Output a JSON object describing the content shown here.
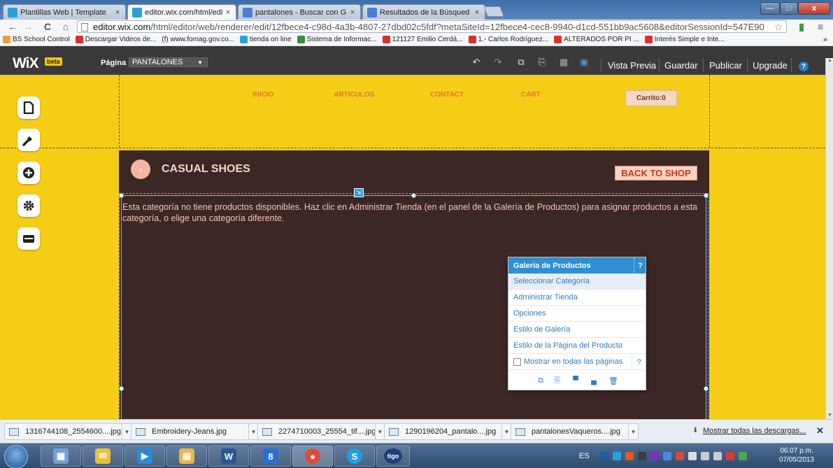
{
  "browser": {
    "tabs": [
      {
        "label": "Plantillas Web | Template",
        "icon_color": "#2a9fd8"
      },
      {
        "label": "editor.wix.com/html/edito",
        "icon_color": "#2a9fd8"
      },
      {
        "label": "pantalones - Buscar con G",
        "icon_color": "#4a7fd8"
      },
      {
        "label": "Resultados de la Búsqued",
        "icon_color": "#4a7fd8"
      }
    ],
    "close_glyph": "×",
    "window_controls": {
      "minimize": "—",
      "maximize": "□",
      "close": "x"
    },
    "nav": {
      "back": "←",
      "forward": "→",
      "reload": "C",
      "home": "⌂"
    },
    "url_domain": "editor.wix.com",
    "url_rest": "/html/editor/web/renderer/edit/12fbece4-c98d-4a3b-4807-27dbd02c5fdf?metaSiteId=12fbece4-cec8-9940-d1cd-551bb9ac5608&editorSessionId=547E90",
    "star_glyph": "☆",
    "menu_glyph": "≡",
    "bookmarks": [
      {
        "label": "BS School Control",
        "color": "#e6a23c"
      },
      {
        "label": "Descargar Videos de...",
        "color": "#d9322b"
      },
      {
        "label": "(f) www.fomag.gov.co...",
        "color": "#f5f6f7"
      },
      {
        "label": "tienda on line",
        "color": "#2a9fd8"
      },
      {
        "label": "Sistema de Informac...",
        "color": "#3a8a3a"
      },
      {
        "label": "121127 Emilio Cerdá...",
        "color": "#d9322b"
      },
      {
        "label": "1.- Carlos Rodríguez...",
        "color": "#d9322b"
      },
      {
        "label": "ALTERADOS POR PI ...",
        "color": "#d9322b"
      },
      {
        "label": "Interés Simple e Inte...",
        "color": "#d9322b"
      }
    ],
    "bookmarks_more": "»"
  },
  "wix": {
    "logo": "WiX",
    "beta": "beta",
    "page_label": "Página",
    "page_value": "PANTALONES",
    "page_caret": "▼",
    "tools": [
      "↶",
      "↷",
      "⧉",
      "⎘",
      "▦",
      "▣"
    ],
    "buttons": {
      "preview": "Vista Previa",
      "save": "Guardar",
      "publish": "Publicar",
      "upgrade": "Upgrade"
    },
    "help": "?"
  },
  "site": {
    "menu": [
      "INICIO",
      "ARTICULOS",
      "CONTACT",
      "CART"
    ],
    "cart": "Carrito:0",
    "sidebar_icons": [
      "page-icon",
      "design-icon",
      "add-icon",
      "settings-icon",
      "store-icon"
    ],
    "category_title": "CASUAL SHOES",
    "back_to_shop": "BACK TO SHOP",
    "empty_message": "Esta categoría no tiene productos disponibles. Haz clic en Administrar Tienda (en el panel de la Galería de Productos) para asignar productos a esta categoría, o elige una categoría diferente."
  },
  "panel": {
    "title": "Galería de Productos",
    "help": "?",
    "items": [
      "Seleccionar Categoría",
      "Administrar Tienda",
      "Opciones",
      "Estilo de Galería",
      "Estilo de la Página del Producto"
    ],
    "checkbox_label": "Mostrar en todas las páginas",
    "checkbox_checked": false,
    "checkbox_help": "?",
    "icons": [
      "⧉",
      "⎘",
      "▀",
      "▄",
      "🗑"
    ]
  },
  "downloads": {
    "files": [
      "1316744108_2554600....jpg",
      "Embroidery-Jeans.jpg",
      "2274710003_25554_tif....jpg",
      "1290196204_pantalo....jpg",
      "pantalonesVaqueros....jpg"
    ],
    "dropdown_glyph": "▼",
    "show_all": "Mostrar todas las descargas...",
    "close": "✕"
  },
  "taskbar": {
    "apps": [
      {
        "name": "calculator",
        "color": "#6ea3d8",
        "glyph": "▦"
      },
      {
        "name": "mail",
        "color": "#e8c23a",
        "glyph": "✉"
      },
      {
        "name": "media-player",
        "color": "#2e8ad6",
        "glyph": "▶"
      },
      {
        "name": "file-explorer",
        "color": "#e8b84a",
        "glyph": "▤"
      },
      {
        "name": "word",
        "color": "#2b5797",
        "glyph": "W"
      },
      {
        "name": "google",
        "color": "#2c6fd1",
        "glyph": "8"
      },
      {
        "name": "chrome",
        "color": "#e04a3a",
        "glyph": "●"
      },
      {
        "name": "skype",
        "color": "#1da0e2",
        "glyph": "S"
      },
      {
        "name": "tigo",
        "color": "#1f3e7a",
        "glyph": "tigo"
      }
    ],
    "language": "ES",
    "tray_colors": [
      "#1e5ba8",
      "#2aa0d8",
      "#e05a1a",
      "#3d3d3d",
      "#7b2fbf",
      "#4a8ad8",
      "#d84a3a",
      "#dddddd",
      "#cccccc",
      "#cccccc",
      "#d83a3a",
      "#4aa84a"
    ],
    "time": "06:07 p.m.",
    "date": "07/05/2013"
  }
}
